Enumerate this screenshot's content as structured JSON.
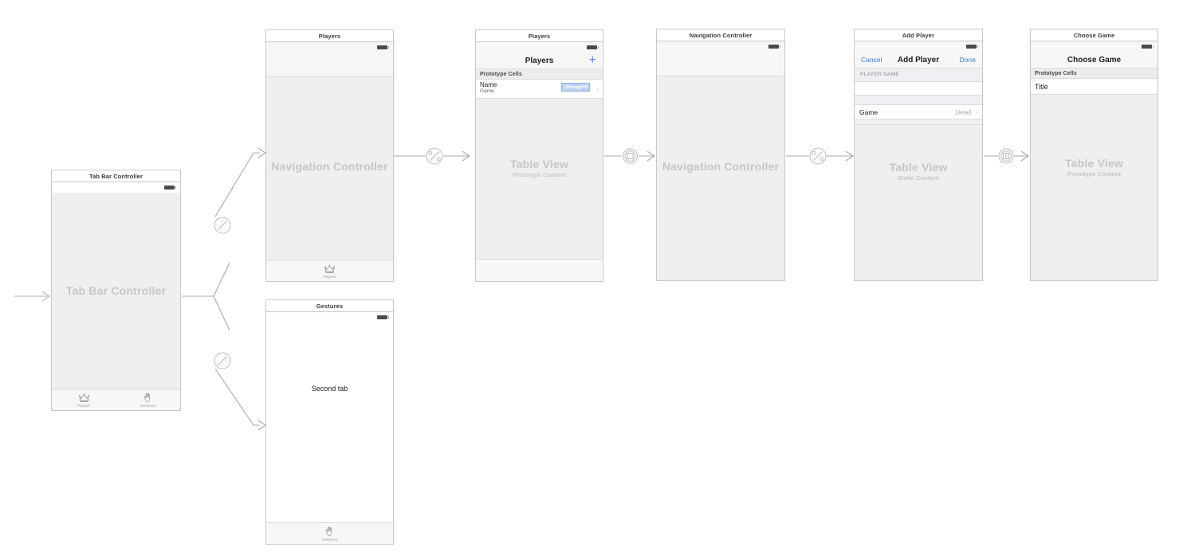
{
  "canvas": {
    "kind": "xcode-storyboard",
    "background": "#ffffff",
    "wire_color": "#a8a8a8",
    "placeholder_color": "#c6c6c6",
    "tint_color": "#2f7fe8"
  },
  "scenes": {
    "tab_bar_controller": {
      "scene_title": "Tab Bar Controller",
      "placeholder_title": "Tab Bar Controller",
      "tabs": [
        {
          "label": "Players",
          "icon": "crown-icon"
        },
        {
          "label": "Gestures",
          "icon": "hand-icon"
        }
      ]
    },
    "players_navigation_controller": {
      "scene_title": "Players",
      "placeholder_title": "Navigation Controller",
      "tabs": [
        {
          "label": "Players",
          "icon": "crown-icon"
        }
      ]
    },
    "gestures_view_controller": {
      "scene_title": "Gestures",
      "body_label": "Second tab",
      "tabs": [
        {
          "label": "Gestures",
          "icon": "hand-icon"
        }
      ]
    },
    "players_table_view": {
      "scene_title": "Players",
      "nav_title": "Players",
      "add_button": "+",
      "section_header": "Prototype Cells",
      "cell": {
        "title": "Name",
        "subtitle": "Game",
        "image_view_label": "UIImageVi",
        "accessory": "disclosure-indicator"
      },
      "placeholder_title": "Table View",
      "placeholder_subtitle": "Prototype Content"
    },
    "add_player_navigation_controller": {
      "scene_title": "Navigation Controller",
      "placeholder_title": "Navigation Controller"
    },
    "add_player_table_view": {
      "scene_title": "Add Player",
      "nav_left_button": "Cancel",
      "nav_title": "Add Player",
      "nav_right_button": "Done",
      "section_header": "PLAYER NAME",
      "name_field_value": "",
      "game_row": {
        "label": "Game",
        "detail": "Detail",
        "accessory": "disclosure-indicator"
      },
      "placeholder_title": "Table View",
      "placeholder_subtitle": "Static Content"
    },
    "choose_game_table_view": {
      "scene_title": "Choose Game",
      "nav_title": "Choose Game",
      "section_header": "Prototype Cells",
      "cell": {
        "title": "Title"
      },
      "placeholder_title": "Table View",
      "placeholder_subtitle": "Prototype Content"
    }
  },
  "segues": {
    "initial_entry": {
      "name": "initial-view-controller-arrow"
    },
    "tab_to_players_nav": {
      "kind": "relationship-segue",
      "icon": "relationship-badge"
    },
    "tab_to_gestures": {
      "kind": "relationship-segue",
      "icon": "relationship-badge"
    },
    "players_nav_to_table": {
      "kind": "relationship-segue",
      "icon": "relationship-badge"
    },
    "players_to_add_nav": {
      "kind": "present-modally-segue",
      "icon": "modal-badge"
    },
    "add_nav_to_add_table": {
      "kind": "relationship-segue",
      "icon": "relationship-badge"
    },
    "add_to_choose_game": {
      "kind": "show-segue",
      "icon": "push-badge"
    }
  }
}
